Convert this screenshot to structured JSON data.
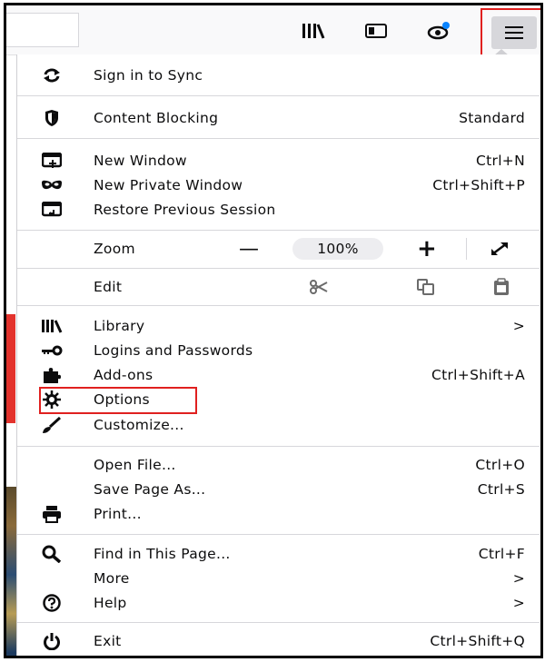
{
  "toolbar": {
    "icons": [
      "library-icon",
      "sidebar-icon",
      "extension-icon",
      "hamburger-menu-icon"
    ]
  },
  "menu": {
    "sign_in": "Sign in to Sync",
    "content_blocking": {
      "label": "Content Blocking",
      "value": "Standard"
    },
    "new_window": {
      "label": "New Window",
      "shortcut": "Ctrl+N"
    },
    "new_private_window": {
      "label": "New Private Window",
      "shortcut": "Ctrl+Shift+P"
    },
    "restore_session": "Restore Previous Session",
    "zoom": {
      "label": "Zoom",
      "minus": "—",
      "level": "100%",
      "plus": "+"
    },
    "edit": {
      "label": "Edit"
    },
    "library": {
      "label": "Library",
      "arrow": ">"
    },
    "logins": "Logins and Passwords",
    "addons": {
      "label": "Add-ons",
      "shortcut": "Ctrl+Shift+A"
    },
    "options": "Options",
    "customize": "Customize...",
    "open_file": {
      "label": "Open File...",
      "shortcut": "Ctrl+O"
    },
    "save_page": {
      "label": "Save Page As...",
      "shortcut": "Ctrl+S"
    },
    "print": "Print...",
    "find": {
      "label": "Find in This Page...",
      "shortcut": "Ctrl+F"
    },
    "more": {
      "label": "More",
      "arrow": ">"
    },
    "help": {
      "label": "Help",
      "arrow": ">"
    },
    "exit": {
      "label": "Exit",
      "shortcut": "Ctrl+Shift+Q"
    }
  },
  "colors": {
    "highlight": "#e0201f",
    "accent_blue": "#0a84ff"
  }
}
